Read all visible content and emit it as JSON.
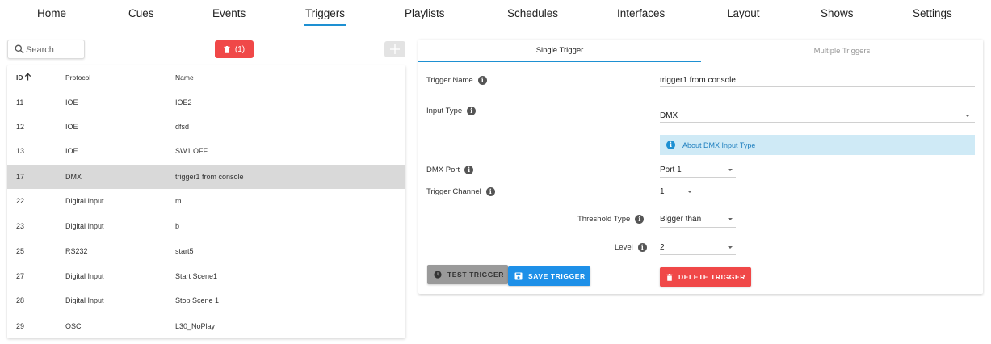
{
  "nav": {
    "items": [
      {
        "label": "Home"
      },
      {
        "label": "Cues"
      },
      {
        "label": "Events"
      },
      {
        "label": "Triggers",
        "active": true
      },
      {
        "label": "Playlists"
      },
      {
        "label": "Schedules"
      },
      {
        "label": "Interfaces"
      },
      {
        "label": "Layout"
      },
      {
        "label": "Shows"
      },
      {
        "label": "Settings"
      }
    ],
    "active_color": "#1e90d2"
  },
  "toolbar": {
    "search_placeholder": "Search",
    "delete_count_label": "(1)",
    "delete_color": "#f04848"
  },
  "table": {
    "headers": {
      "id": "ID",
      "protocol": "Protocol",
      "name": "Name"
    },
    "sort_column": "ID",
    "sort_direction": "ascending",
    "rows": [
      {
        "id": "11",
        "protocol": "IOE",
        "name": "IOE2"
      },
      {
        "id": "12",
        "protocol": "IOE",
        "name": "dfsd"
      },
      {
        "id": "13",
        "protocol": "IOE",
        "name": "SW1 OFF"
      },
      {
        "id": "17",
        "protocol": "DMX",
        "name": "trigger1 from console",
        "selected": true
      },
      {
        "id": "22",
        "protocol": "Digital Input",
        "name": "m"
      },
      {
        "id": "23",
        "protocol": "Digital Input",
        "name": "b"
      },
      {
        "id": "25",
        "protocol": "RS232",
        "name": "start5"
      },
      {
        "id": "27",
        "protocol": "Digital Input",
        "name": "Start Scene1"
      },
      {
        "id": "28",
        "protocol": "Digital Input",
        "name": "Stop Scene 1"
      },
      {
        "id": "29",
        "protocol": "OSC",
        "name": "L30_NoPlay"
      }
    ]
  },
  "panel": {
    "tabs": [
      {
        "label": "Single Trigger",
        "active": true
      },
      {
        "label": "Multiple Triggers"
      }
    ],
    "trigger_name": {
      "label": "Trigger Name",
      "value": "trigger1 from console"
    },
    "input_type": {
      "label": "Input Type",
      "value": "DMX"
    },
    "about_link": "About DMX Input Type",
    "dmx_port": {
      "label": "DMX Port",
      "value": "Port 1"
    },
    "trigger_channel": {
      "label": "Trigger Channel",
      "value": "1"
    },
    "threshold_type": {
      "label": "Threshold Type",
      "value": "Bigger than"
    },
    "level": {
      "label": "Level",
      "value": "2"
    },
    "buttons": {
      "test": "TEST TRIGGER",
      "save": "SAVE TRIGGER",
      "delete": "DELETE TRIGGER"
    }
  }
}
